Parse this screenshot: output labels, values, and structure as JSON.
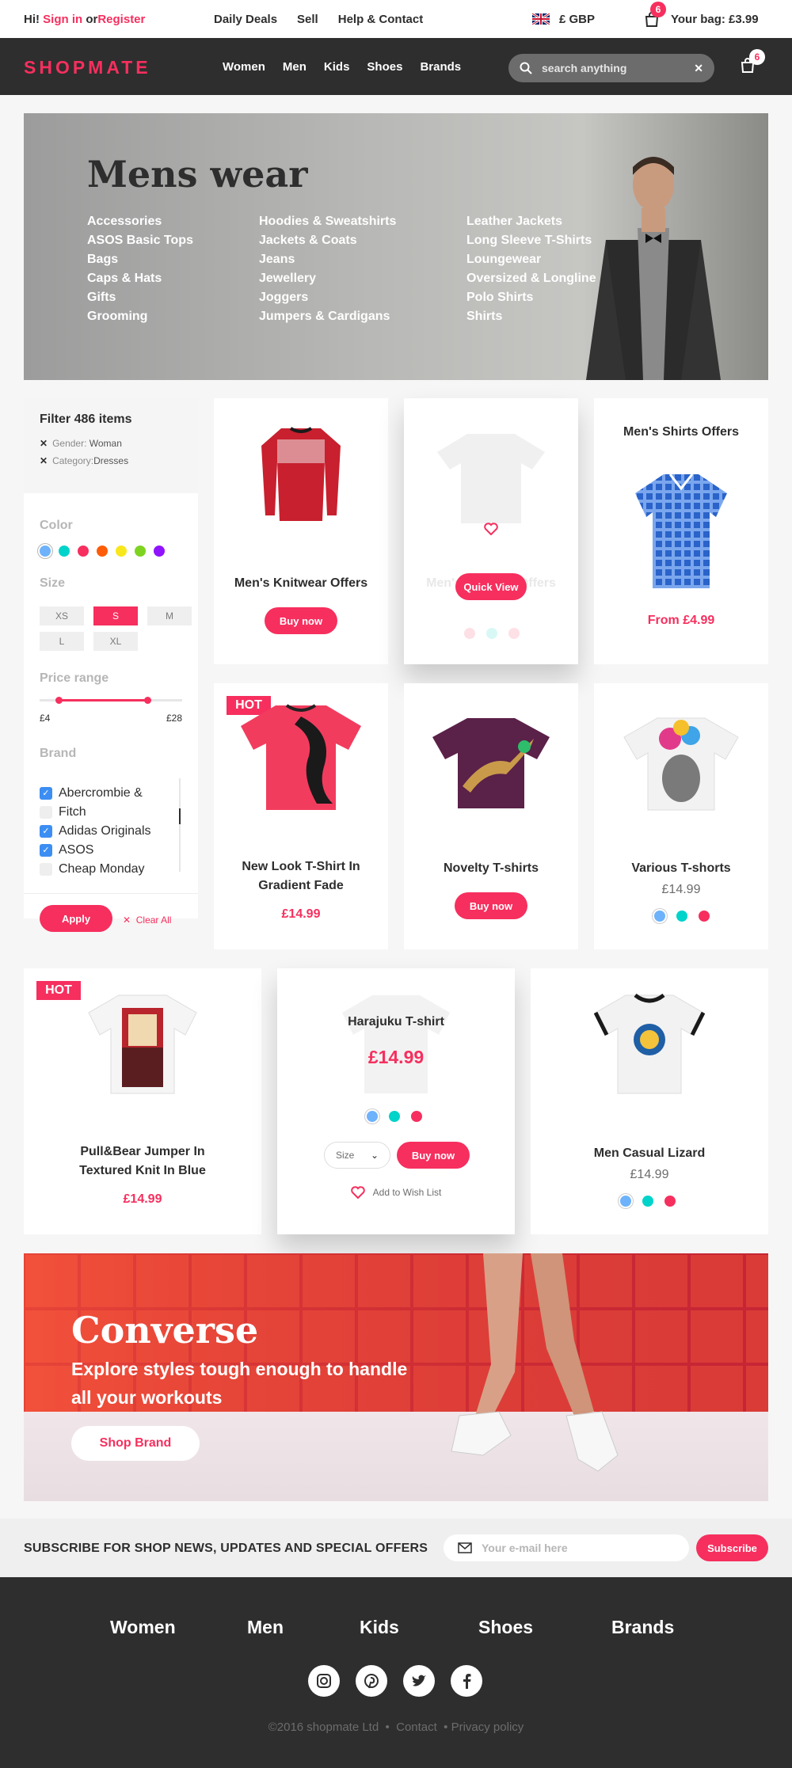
{
  "topbar": {
    "greeting": "Hi!",
    "signin": "Sign in",
    "or": "or",
    "register": "Register",
    "links": [
      "Daily Deals",
      "Sell",
      "Help & Contact"
    ],
    "currency": "£ GBP",
    "bag_count": "6",
    "bag_label": "Your bag: £3.99"
  },
  "nav": {
    "logo": "SHOPMATE",
    "menu": [
      "Women",
      "Men",
      "Kids",
      "Shoes",
      "Brands"
    ],
    "search_placeholder": "search anything",
    "bag_count": "6"
  },
  "hero": {
    "title": "Mens wear",
    "col1": [
      "Accessories",
      "ASOS Basic Tops",
      "Bags",
      "Caps & Hats",
      "Gifts",
      "Grooming"
    ],
    "col2": [
      "Hoodies & Sweatshirts",
      "Jackets & Coats",
      "Jeans",
      "Jewellery",
      "Joggers",
      "Jumpers & Cardigans"
    ],
    "col3": [
      "Leather Jackets",
      "Long Sleeve T-Shirts",
      "Loungewear",
      "Oversized & Longline",
      "Polo Shirts",
      "Shirts"
    ]
  },
  "filter": {
    "title": "Filter 486 items",
    "chips": [
      {
        "key": "Gender:",
        "value": "Woman"
      },
      {
        "key": "Category:",
        "value": "Dresses"
      }
    ],
    "color_label": "Color",
    "colors": [
      "#6eb2fb",
      "#00d3ca",
      "#f62f5e",
      "#fe5c07",
      "#f8e71c",
      "#7ed321",
      "#9013fe"
    ],
    "size_label": "Size",
    "sizes": [
      "XS",
      "S",
      "M",
      "L",
      "XL"
    ],
    "selected_size": "S",
    "price_label": "Price range",
    "price_min": "£4",
    "price_max": "£28",
    "brand_label": "Brand",
    "brands": [
      {
        "name": "Abercrombie &",
        "checked": true
      },
      {
        "name": "Fitch",
        "checked": false
      },
      {
        "name": "Adidas Originals",
        "checked": true
      },
      {
        "name": "ASOS",
        "checked": true
      },
      {
        "name": "Cheap Monday",
        "checked": false
      }
    ],
    "apply": "Apply",
    "clear_all": "Clear All"
  },
  "products": {
    "p1": {
      "title": "Men's Knitwear Offers",
      "button": "Buy now"
    },
    "p2": {
      "title": "Men's Shirts Offers",
      "button": "Quick View",
      "title_hidden": "Men's Hoodies Offers"
    },
    "p3": {
      "title": "Men's Shirts Offers",
      "price": "From £4.99"
    },
    "p4": {
      "badge": "HOT",
      "title1": "New Look T-Shirt In",
      "title2": "Gradient Fade",
      "price": "£14.99"
    },
    "p5": {
      "title": "Novelty T-shirts",
      "button": "Buy now"
    },
    "p6": {
      "title": "Various T-shorts",
      "price": "£14.99"
    },
    "p7": {
      "badge": "HOT",
      "title1": "Pull&Bear Jumper In",
      "title2": "Textured Knit In Blue",
      "price": "£14.99"
    },
    "p8": {
      "title": "Harajuku T-shirt",
      "price": "£14.99",
      "size": "Size",
      "button": "Buy now",
      "wishlist": "Add to Wish List"
    },
    "p9": {
      "title": "Men Casual Lizard",
      "price": "£14.99"
    }
  },
  "banner": {
    "title": "Converse",
    "text": "Explore styles tough enough to handle all your workouts",
    "button": "Shop Brand"
  },
  "subscribe": {
    "text": "SUBSCRIBE FOR SHOP NEWS, UPDATES AND SPECIAL OFFERS",
    "placeholder": "Your e-mail here",
    "button": "Subscribe"
  },
  "footer": {
    "menu": [
      "Women",
      "Men",
      "Kids",
      "Shoes",
      "Brands"
    ],
    "social": [
      "instagram-icon",
      "pinterest-icon",
      "twitter-icon",
      "facebook-icon"
    ],
    "copyright": "©2016 shopmate Ltd",
    "contact": "Contact",
    "privacy": "Privacy policy"
  }
}
